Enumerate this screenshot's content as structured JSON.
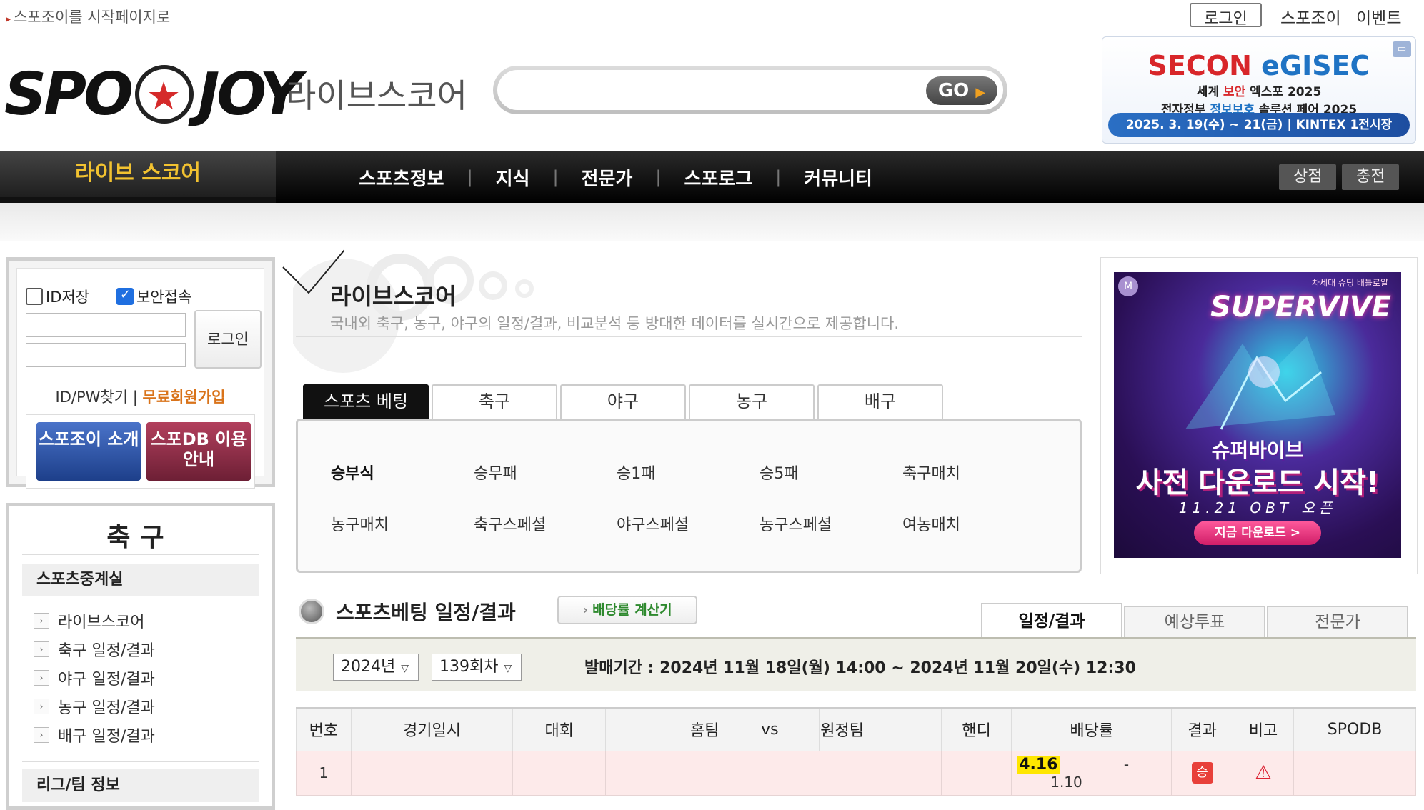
{
  "topbar": {
    "home_link": "스포조이를 시작페이지로",
    "login_button": "로그인",
    "links": [
      "스포조이",
      "이벤트"
    ]
  },
  "logo": {
    "left": "SPO",
    "right": "JOY",
    "subtitle": "라이브스코어"
  },
  "search": {
    "placeholder": "",
    "go_label": "GO"
  },
  "banner_top": {
    "secon": "SECON",
    "egisec": "eGISEC",
    "line1_a": "세계 ",
    "line1_b": "보안",
    "line1_c": " 엑스포 2025",
    "line2_a": "전자정부 ",
    "line2_b": "정보보호",
    "line2_c": " 솔루션 페어 2025",
    "date": "2025. 3. 19(수) ~ 21(금) | KINTEX 1전시장"
  },
  "nav": {
    "active": "라이브 스코어",
    "items": [
      "스포츠정보",
      "지식",
      "전문가",
      "스포로그",
      "커뮤니티"
    ],
    "right_buttons": [
      "상점",
      "충전"
    ]
  },
  "login": {
    "save_id": "ID저장",
    "secure": "보안접속",
    "button": "로그인",
    "find": "ID/PW찾기",
    "separator": "|",
    "join": "무료회원가입",
    "promo1": "스포조이 소개",
    "promo2": "스포DB 이용안내"
  },
  "menu": {
    "title": "축구",
    "section1": "스포츠중계실",
    "items": [
      "라이브스코어",
      "축구 일정/결과",
      "야구 일정/결과",
      "농구 일정/결과",
      "배구 일정/결과"
    ],
    "section2": "리그/팀 정보"
  },
  "livescore": {
    "title": "라이브스코어",
    "desc": "국내외 축구, 농구, 야구의 일정/결과, 비교분석 등 방대한 데이터를 실시간으로 제공합니다."
  },
  "tabs": [
    "스포츠 베팅",
    "축구",
    "야구",
    "농구",
    "배구"
  ],
  "tab_panel": {
    "row1": [
      "승부식",
      "승무패",
      "승1패",
      "승5패",
      "축구매치"
    ],
    "row2": [
      "농구매치",
      "축구스페셜",
      "야구스페셜",
      "농구스페셜",
      "여농매치"
    ]
  },
  "right_banner": {
    "badge": "M",
    "top_text": "차세대 슈팅 배틀로얄",
    "logo": "SUPERVIVE",
    "big1": "슈퍼바이브",
    "big2": "사전 다운로드 시작!",
    "obt": "11.21 OBT 오픈",
    "cta": "지금 다운로드 >"
  },
  "schedule": {
    "title": "스포츠베팅 일정/결과",
    "calc": "배당률 계산기",
    "tabs": [
      "일정/결과",
      "예상투표",
      "전문가"
    ],
    "year": "2024년",
    "round": "139회차",
    "period": "발매기간 : 2024년 11월 18일(월) 14:00 ~ 2024년 11월 20일(수) 12:30"
  },
  "table": {
    "headers": [
      "번호",
      "경기일시",
      "대회",
      "홈팀",
      "vs",
      "원정팀",
      "핸디",
      "배당률",
      "결과",
      "비고",
      "SPODB"
    ],
    "rows": [
      {
        "no": "1",
        "odds_win": "4.16",
        "odds_draw": "-",
        "odds_lose": "1.10",
        "result": "승"
      }
    ]
  },
  "colors": {
    "accent": "#f2c230",
    "join": "#d9731a",
    "result": "#e8403a",
    "highlight": "#ffe600"
  }
}
